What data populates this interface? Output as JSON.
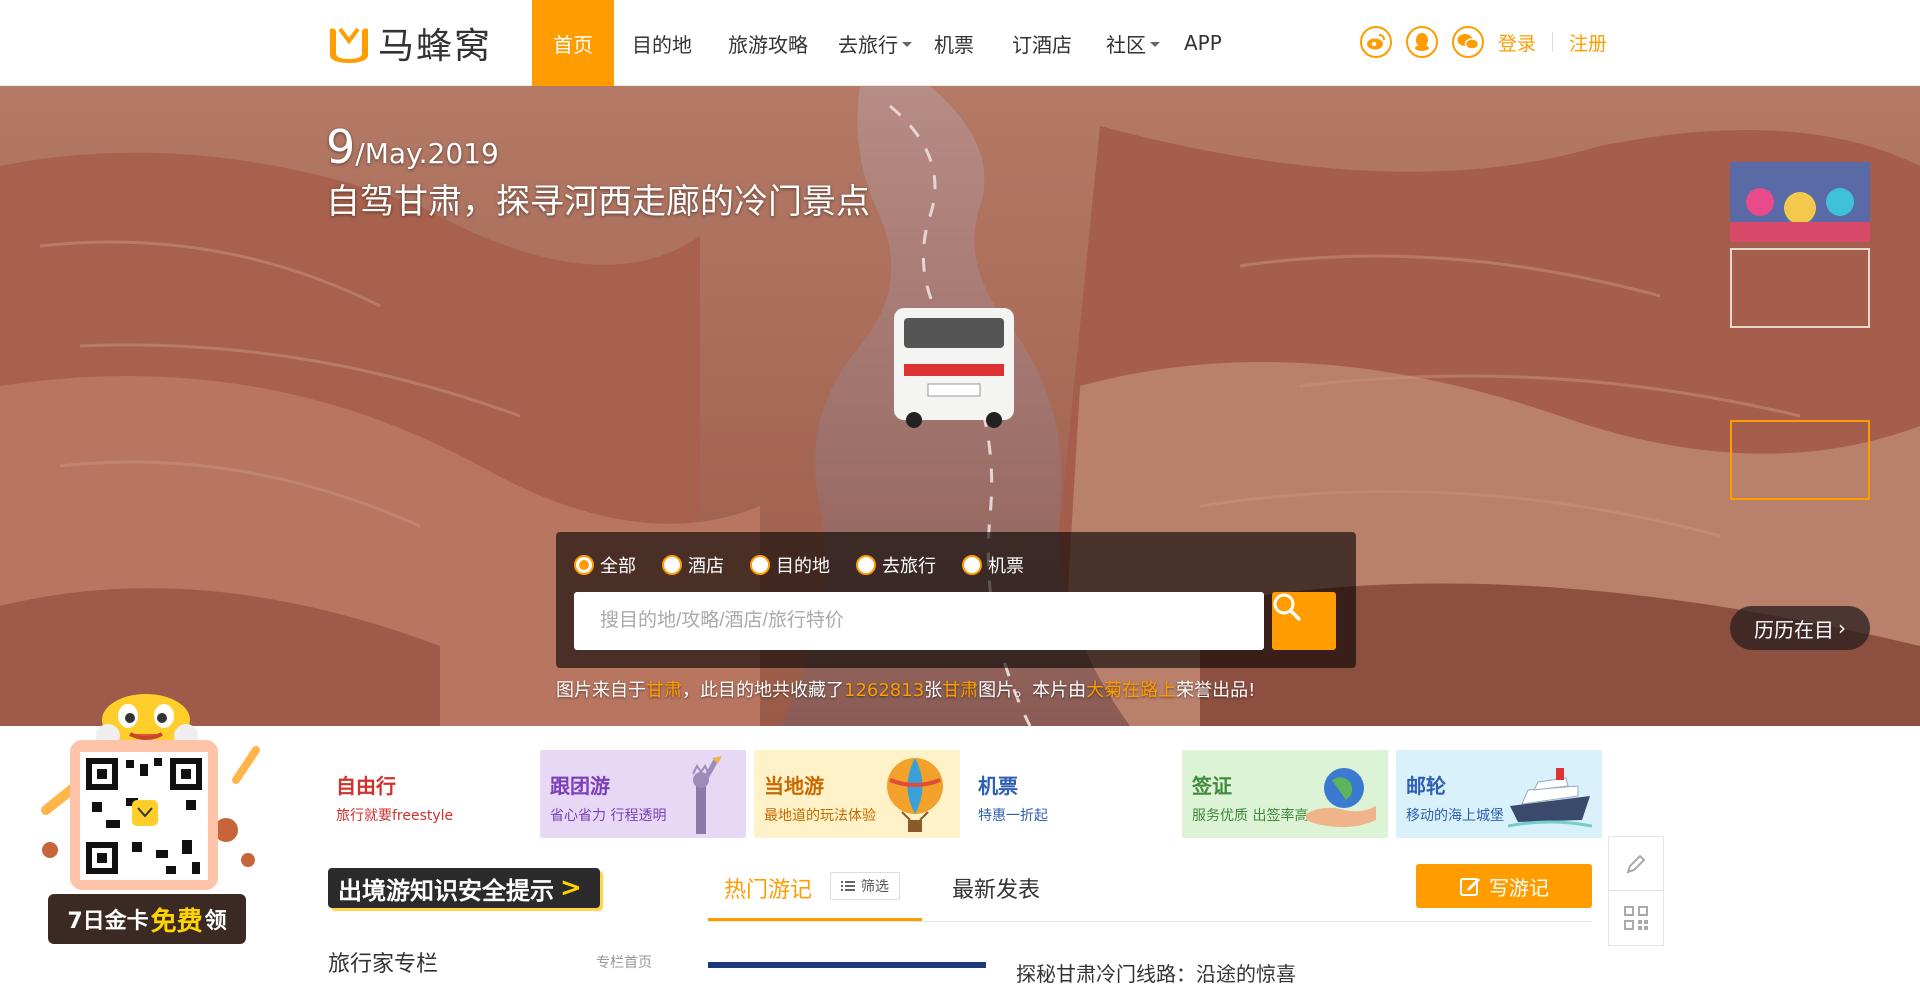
{
  "header": {
    "logo_text": "马蜂窝",
    "nav": [
      {
        "label": "首页",
        "active": true
      },
      {
        "label": "目的地"
      },
      {
        "label": "旅游攻略"
      },
      {
        "label": "去旅行",
        "dropdown": true
      },
      {
        "label": "机票"
      },
      {
        "label": "订酒店"
      },
      {
        "label": "社区",
        "dropdown": true
      },
      {
        "label": "APP"
      }
    ],
    "social_icons": [
      "weibo-icon",
      "qq-icon",
      "wechat-icon"
    ],
    "login": "登录",
    "register": "注册"
  },
  "hero": {
    "day": "9",
    "month_year": "/May.2019",
    "title": "自驾甘肃，探寻河西走廊的冷门景点",
    "history_button": "历历在目",
    "thumbnails": 5,
    "selected_thumbnail": 4
  },
  "search": {
    "options": [
      "全部",
      "酒店",
      "目的地",
      "去旅行",
      "机票"
    ],
    "selected": "全部",
    "placeholder": "搜目的地/攻略/酒店/旅行特价"
  },
  "credit": {
    "p1": "图片来自于",
    "place1": "甘肃",
    "p2": "，此目的地共收藏了",
    "count": "1262813",
    "p3": "张",
    "place2": "甘肃",
    "p4": "图片。本片由",
    "author": "大菊在路上",
    "p5": "荣誉出品!"
  },
  "promo": {
    "label_a": "7日金卡",
    "label_free": "免费",
    "label_b": "领"
  },
  "categories": [
    {
      "title": "自由行",
      "sub": "旅行就要freestyle",
      "color": "#d0312d",
      "bg": "#ffffff",
      "icon": "none"
    },
    {
      "title": "跟团游",
      "sub": "省心省力 行程透明",
      "color": "#7b3fb6",
      "bg": "#e7d8f6",
      "icon": "statue-of-liberty-icon"
    },
    {
      "title": "当地游",
      "sub": "最地道的玩法体验",
      "color": "#c86a00",
      "bg": "#fff1c8",
      "icon": "hot-air-balloon-icon"
    },
    {
      "title": "机票",
      "sub": "特惠一折起",
      "color": "#2f5fb3",
      "bg": "#ffffff",
      "icon": "none"
    },
    {
      "title": "签证",
      "sub": "服务优质 出签率高",
      "color": "#3f8b3b",
      "bg": "#dcf3d5",
      "icon": "globe-hand-icon"
    },
    {
      "title": "邮轮",
      "sub": "移动的海上城堡",
      "color": "#2f5fb3",
      "bg": "#d8f1fb",
      "icon": "cruise-ship-icon"
    }
  ],
  "safety_banner": "出境游知识安全提示",
  "column": {
    "title": "旅行家专栏",
    "link": "专栏首页"
  },
  "feed_tabs": {
    "hot": "热门游记",
    "filter": "筛选",
    "latest": "最新发表"
  },
  "write_button": "写游记",
  "feed_peek_title": "探秘甘肃冷门线路：沿途的惊喜"
}
